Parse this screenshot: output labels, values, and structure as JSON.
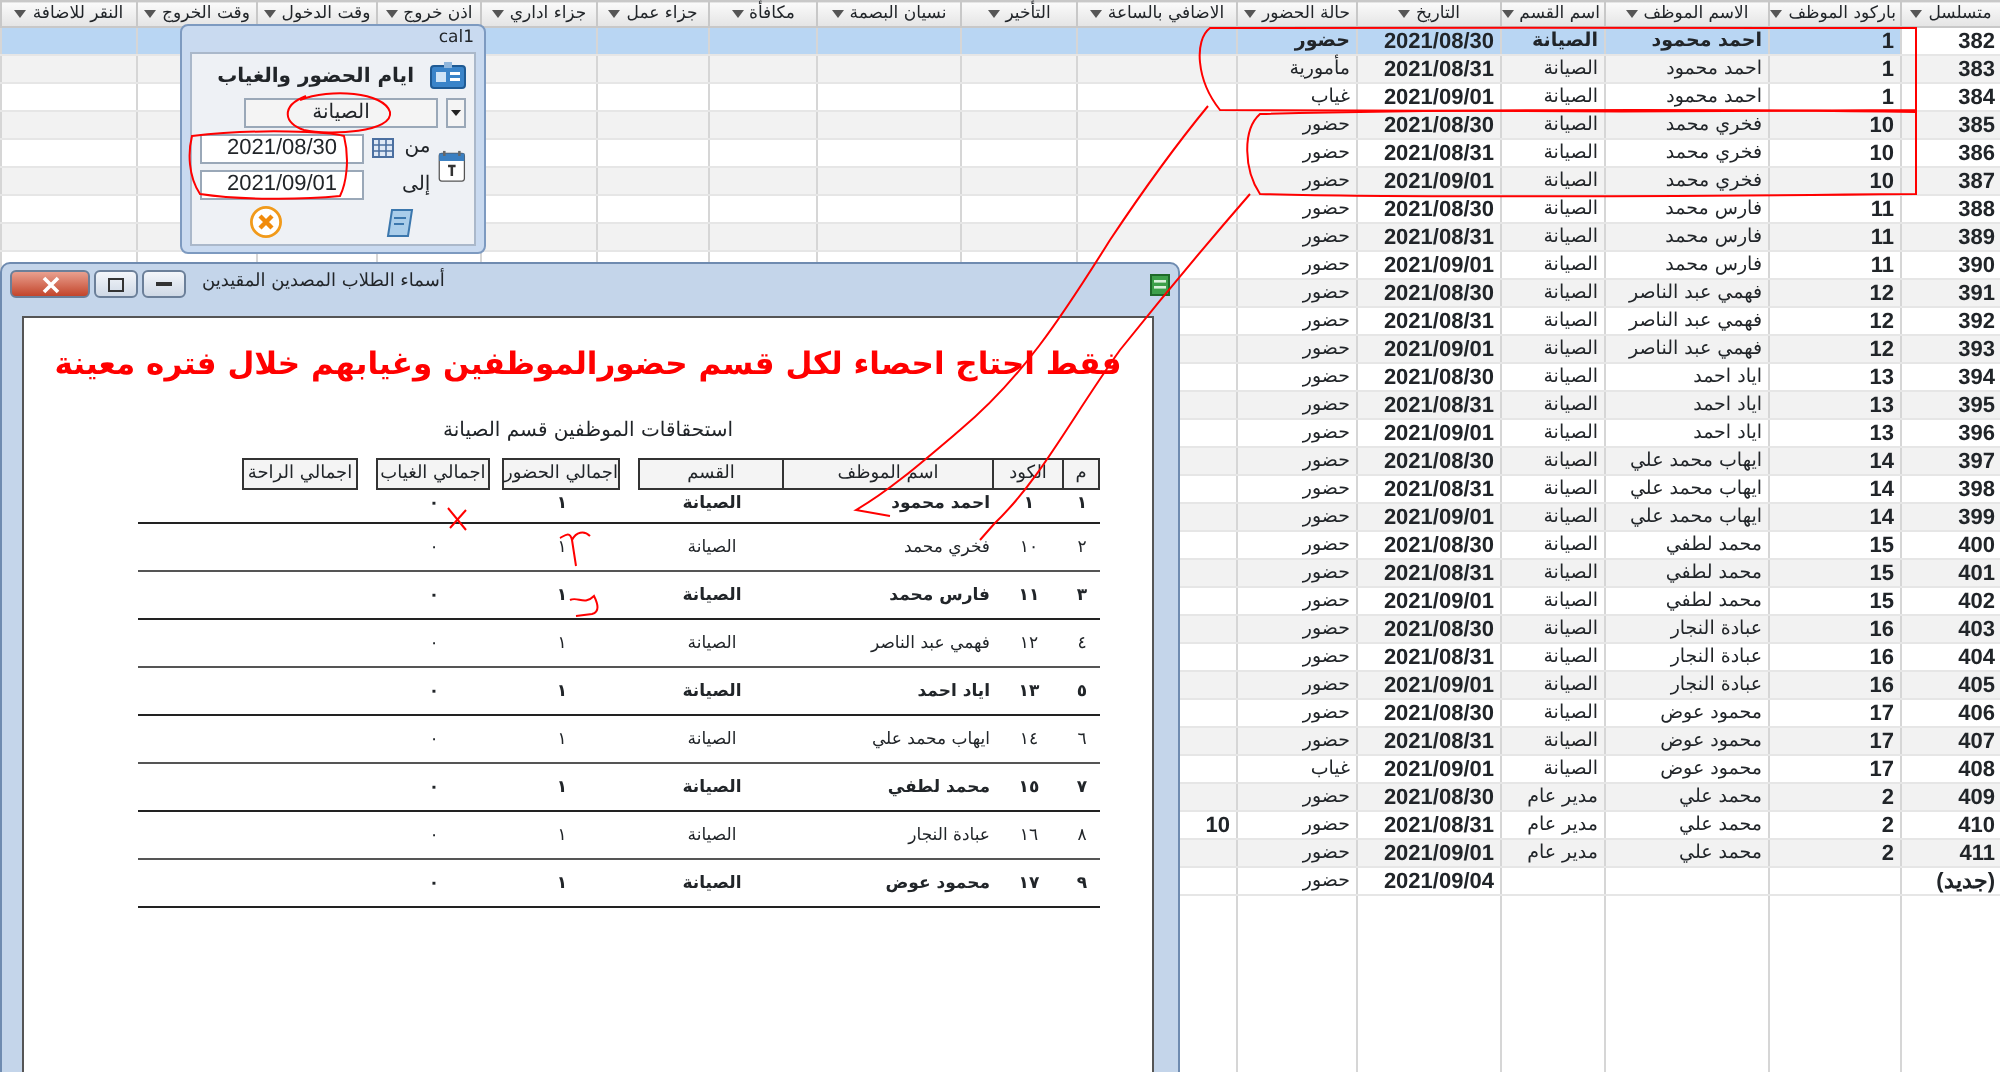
{
  "datasheet": {
    "columns": [
      "متسلسل",
      "باركود الموظف",
      "الاسم الموظف",
      "اسم القسم",
      "التاريخ",
      "حالة الحضور",
      "الاضافي بالساعة",
      "التأخير",
      "نسيان البصمة",
      "مكافأة",
      "جزاء عمل",
      "جزاء اداري",
      "اذن خروج",
      "وقت الدخول",
      "وقت الخروج",
      "النقر للاضافة"
    ],
    "rows": [
      {
        "serial": "382",
        "barcode": "1",
        "name": "احمد محمود",
        "department": "الصيانة",
        "date": "2021/08/30",
        "status": "حضور",
        "selected": true
      },
      {
        "serial": "383",
        "barcode": "1",
        "name": "احمد محمود",
        "department": "الصيانة",
        "date": "2021/08/31",
        "status": "مأمورية",
        "selected": false
      },
      {
        "serial": "384",
        "barcode": "1",
        "name": "احمد محمود",
        "department": "الصيانة",
        "date": "2021/09/01",
        "status": "غياب",
        "selected": false
      },
      {
        "serial": "385",
        "barcode": "10",
        "name": "فخري محمد",
        "department": "الصيانة",
        "date": "2021/08/30",
        "status": "حضور",
        "selected": false
      },
      {
        "serial": "386",
        "barcode": "10",
        "name": "فخري محمد",
        "department": "الصيانة",
        "date": "2021/08/31",
        "status": "حضور",
        "selected": false
      },
      {
        "serial": "387",
        "barcode": "10",
        "name": "فخري محمد",
        "department": "الصيانة",
        "date": "2021/09/01",
        "status": "حضور",
        "selected": false
      },
      {
        "serial": "388",
        "barcode": "11",
        "name": "فارس محمد",
        "department": "الصيانة",
        "date": "2021/08/30",
        "status": "حضور",
        "selected": false
      },
      {
        "serial": "389",
        "barcode": "11",
        "name": "فارس محمد",
        "department": "الصيانة",
        "date": "2021/08/31",
        "status": "حضور",
        "selected": false
      },
      {
        "serial": "390",
        "barcode": "11",
        "name": "فارس محمد",
        "department": "الصيانة",
        "date": "2021/09/01",
        "status": "حضور",
        "selected": false
      },
      {
        "serial": "391",
        "barcode": "12",
        "name": "فهمي عبد الناصر",
        "department": "الصيانة",
        "date": "2021/08/30",
        "status": "حضور",
        "selected": false
      },
      {
        "serial": "392",
        "barcode": "12",
        "name": "فهمي عبد الناصر",
        "department": "الصيانة",
        "date": "2021/08/31",
        "status": "حضور",
        "selected": false
      },
      {
        "serial": "393",
        "barcode": "12",
        "name": "فهمي عبد الناصر",
        "department": "الصيانة",
        "date": "2021/09/01",
        "status": "حضور",
        "selected": false
      },
      {
        "serial": "394",
        "barcode": "13",
        "name": "اياد احمد",
        "department": "الصيانة",
        "date": "2021/08/30",
        "status": "حضور",
        "selected": false
      },
      {
        "serial": "395",
        "barcode": "13",
        "name": "اياد احمد",
        "department": "الصيانة",
        "date": "2021/08/31",
        "status": "حضور",
        "selected": false
      },
      {
        "serial": "396",
        "barcode": "13",
        "name": "اياد احمد",
        "department": "الصيانة",
        "date": "2021/09/01",
        "status": "حضور",
        "selected": false
      },
      {
        "serial": "397",
        "barcode": "14",
        "name": "ايهاب محمد علي",
        "department": "الصيانة",
        "date": "2021/08/30",
        "status": "حضور",
        "selected": false
      },
      {
        "serial": "398",
        "barcode": "14",
        "name": "ايهاب محمد علي",
        "department": "الصيانة",
        "date": "2021/08/31",
        "status": "حضور",
        "selected": false
      },
      {
        "serial": "399",
        "barcode": "14",
        "name": "ايهاب محمد علي",
        "department": "الصيانة",
        "date": "2021/09/01",
        "status": "حضور",
        "selected": false
      },
      {
        "serial": "400",
        "barcode": "15",
        "name": "محمد لطفي",
        "department": "الصيانة",
        "date": "2021/08/30",
        "status": "حضور",
        "selected": false
      },
      {
        "serial": "401",
        "barcode": "15",
        "name": "محمد لطفي",
        "department": "الصيانة",
        "date": "2021/08/31",
        "status": "حضور",
        "selected": false
      },
      {
        "serial": "402",
        "barcode": "15",
        "name": "محمد لطفي",
        "department": "الصيانة",
        "date": "2021/09/01",
        "status": "حضور",
        "selected": false
      },
      {
        "serial": "403",
        "barcode": "16",
        "name": "عبادة النجار",
        "department": "الصيانة",
        "date": "2021/08/30",
        "status": "حضور",
        "selected": false
      },
      {
        "serial": "404",
        "barcode": "16",
        "name": "عبادة النجار",
        "department": "الصيانة",
        "date": "2021/08/31",
        "status": "حضور",
        "selected": false
      },
      {
        "serial": "405",
        "barcode": "16",
        "name": "عبادة النجار",
        "department": "الصيانة",
        "date": "2021/09/01",
        "status": "حضور",
        "selected": false
      },
      {
        "serial": "406",
        "barcode": "17",
        "name": "محمود عوض",
        "department": "الصيانة",
        "date": "2021/08/30",
        "status": "حضور",
        "selected": false
      },
      {
        "serial": "407",
        "barcode": "17",
        "name": "محمود عوض",
        "department": "الصيانة",
        "date": "2021/08/31",
        "status": "حضور",
        "selected": false
      },
      {
        "serial": "408",
        "barcode": "17",
        "name": "محمود عوض",
        "department": "الصيانة",
        "date": "2021/09/01",
        "status": "غياب",
        "selected": false
      },
      {
        "serial": "409",
        "barcode": "2",
        "name": "محمد علي",
        "department": "مدير عام",
        "date": "2021/08/30",
        "status": "حضور",
        "selected": false
      },
      {
        "serial": "410",
        "barcode": "2",
        "name": "محمد علي",
        "department": "مدير عام",
        "date": "2021/08/31",
        "status": "حضور",
        "overtime": "10",
        "selected": false
      },
      {
        "serial": "411",
        "barcode": "2",
        "name": "محمد علي",
        "department": "مدير عام",
        "date": "2021/09/01",
        "status": "حضور",
        "selected": false
      }
    ],
    "new_row": {
      "serial": "(جديد)",
      "date": "2021/09/04",
      "status": "حضور"
    }
  },
  "attendance_dialog": {
    "title": "cal1",
    "heading": "ايام الحضور والغياب",
    "department": "الصيانة",
    "from_label": "من",
    "from_date": "2021/08/30",
    "to_label": "إلى",
    "to_date": "2021/09/01"
  },
  "report_window": {
    "title": "أسماء الطلاب المصدين المقيدين",
    "note": "فقط احتاج احصاء لكل قسم حضورالموظفين وغيابهم خلال فتره معينة",
    "heading": "استحقاقات الموظفين قسم الصيانة",
    "columns": [
      "م",
      "الكود",
      "اسم الموظف",
      "القسم",
      "اجمالي الحضور",
      "اجمالي الغياب",
      "اجمالي الراحة"
    ],
    "rows": [
      {
        "index": "١",
        "code": "١",
        "name": "احمد محمود",
        "department": "الصيانة",
        "present": "١",
        "absent": "٠"
      },
      {
        "index": "٢",
        "code": "١٠",
        "name": "فخري محمد",
        "department": "الصيانة",
        "present": "١",
        "absent": "٠"
      },
      {
        "index": "٣",
        "code": "١١",
        "name": "فارس محمد",
        "department": "الصيانة",
        "present": "١",
        "absent": "٠"
      },
      {
        "index": "٤",
        "code": "١٢",
        "name": "فهمي عبد الناصر",
        "department": "الصيانة",
        "present": "١",
        "absent": "٠"
      },
      {
        "index": "٥",
        "code": "١٣",
        "name": "اياد احمد",
        "department": "الصيانة",
        "present": "١",
        "absent": "٠"
      },
      {
        "index": "٦",
        "code": "١٤",
        "name": "ايهاب محمد علي",
        "department": "الصيانة",
        "present": "١",
        "absent": "٠"
      },
      {
        "index": "٧",
        "code": "١٥",
        "name": "محمد لطفي",
        "department": "الصيانة",
        "present": "١",
        "absent": "٠"
      },
      {
        "index": "٨",
        "code": "١٦",
        "name": "عبادة النجار",
        "department": "الصيانة",
        "present": "١",
        "absent": "٠"
      },
      {
        "index": "٩",
        "code": "١٧",
        "name": "محمود عوض",
        "department": "الصيانة",
        "present": "١",
        "absent": "٠"
      }
    ]
  }
}
